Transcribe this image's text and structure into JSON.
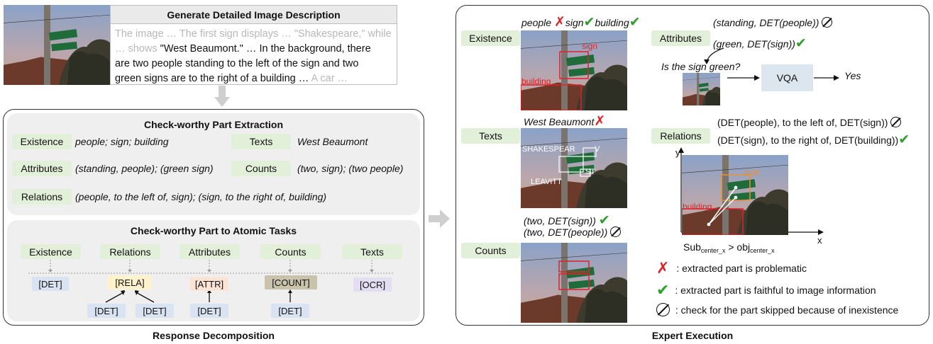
{
  "top": {
    "title": "Generate Detailed Image Description",
    "lines": [
      {
        "faded_a": "The image … The first sign displays … \"Shakespeare,\" while"
      },
      {
        "faded_a": "… shows ",
        "normal": "\"West Beaumont.\" … In the background, there"
      },
      {
        "normal": "are two people standing to the left of the sign and two"
      },
      {
        "normal": "green signs are to the right of a building … ",
        "faded_b": "A car …"
      }
    ]
  },
  "extraction": {
    "title": "Check-worthy Part Extraction",
    "existence_label": "Existence",
    "existence_value": "people; sign; building",
    "texts_label": "Texts",
    "texts_value": "West Beaumont",
    "attributes_label": "Attributes",
    "attributes_value": "(standing, people); (green sign)",
    "counts_label": "Counts",
    "counts_value": "(two, sign); (two people)",
    "relations_label": "Relations",
    "relations_value": "(people, to the left of, sign); (sign, to the right of, building)"
  },
  "atomic": {
    "title": "Check-worthy Part to Atomic Tasks",
    "categories": [
      "Existence",
      "Relations",
      "Attributes",
      "Counts",
      "Texts"
    ],
    "det": "[DET]",
    "rela": "[RELA]",
    "attr": "[ATTR]",
    "count": "[COUNT]",
    "ocr": "[OCR]"
  },
  "captions": {
    "left": "Response Decomposition",
    "right": "Expert Execution"
  },
  "expert": {
    "existence_label": "Existence",
    "exist_people": "people",
    "exist_sign": "sign",
    "exist_building": "building",
    "box_sign": "sign",
    "box_building": "building",
    "texts_label": "Texts",
    "west_beaumont": "West Beaumont",
    "ocr_shakespeare": "SHAKESPEAR",
    "ocr_v": "V",
    "ocr_st": "ST",
    "ocr_leavitt": "LEAVITT",
    "count_sign": "(two, DET(sign))",
    "count_people": "(two, DET(people))",
    "counts_label": "Counts",
    "attributes_label": "Attributes",
    "attr_standing": "(standing, DET(people))",
    "attr_green": "(green, DET(sign))",
    "question": "Is the sign green?",
    "vqa": "VQA",
    "yes": "Yes",
    "relations_label": "Relations",
    "rel_left": "(DET(people), to the left of, DET(sign))",
    "rel_right": "(DET(sign), to the right of, DET(building))",
    "axis_y": "y",
    "axis_x": "x",
    "plot_sign": "sign",
    "plot_building": "building",
    "formula_sub": "Sub",
    "formula_sub_idx": "center_x",
    "formula_gt": " > obj",
    "formula_obj_idx": "center_x"
  },
  "legend": {
    "cross": ": extracted part is problematic",
    "check": ": extracted part is faithful to image information",
    "skip": ": check for the part skipped because of inexistence"
  },
  "colors": {
    "check": "#2e9e2e",
    "cross": "#e0212b",
    "tag": "#e2efd9",
    "panel": "#efefef"
  }
}
